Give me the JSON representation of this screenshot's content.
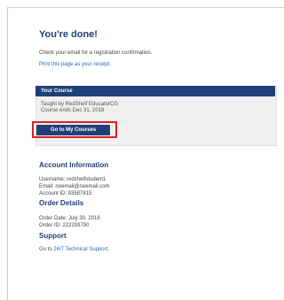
{
  "heading": "You're done!",
  "intro": {
    "email_text": "Check your email for a registration confirmation.",
    "print_link": "Print this page as your receipt."
  },
  "course": {
    "section_title": "Your Course",
    "taught_by": "Taught by RedShelf EducatorCG",
    "ends": "Course ends Dec 31, 2018",
    "button_label": "Go to My Courses"
  },
  "account": {
    "title": "Account Information",
    "username": "Username: redshelfstudent1",
    "email": "Email: noemail@noemail.com",
    "account_id": "Account ID: 93587815"
  },
  "order": {
    "title": "Order Details",
    "date": "Order Date: July 30, 2018",
    "id": "Order ID: 222293790"
  },
  "support": {
    "title": "Support",
    "prefix": "Go to ",
    "link": "24/7 Technical Support",
    "suffix": "."
  },
  "colors": {
    "primary": "#1f3f78",
    "link": "#2a64b8",
    "highlight": "#e02020"
  }
}
